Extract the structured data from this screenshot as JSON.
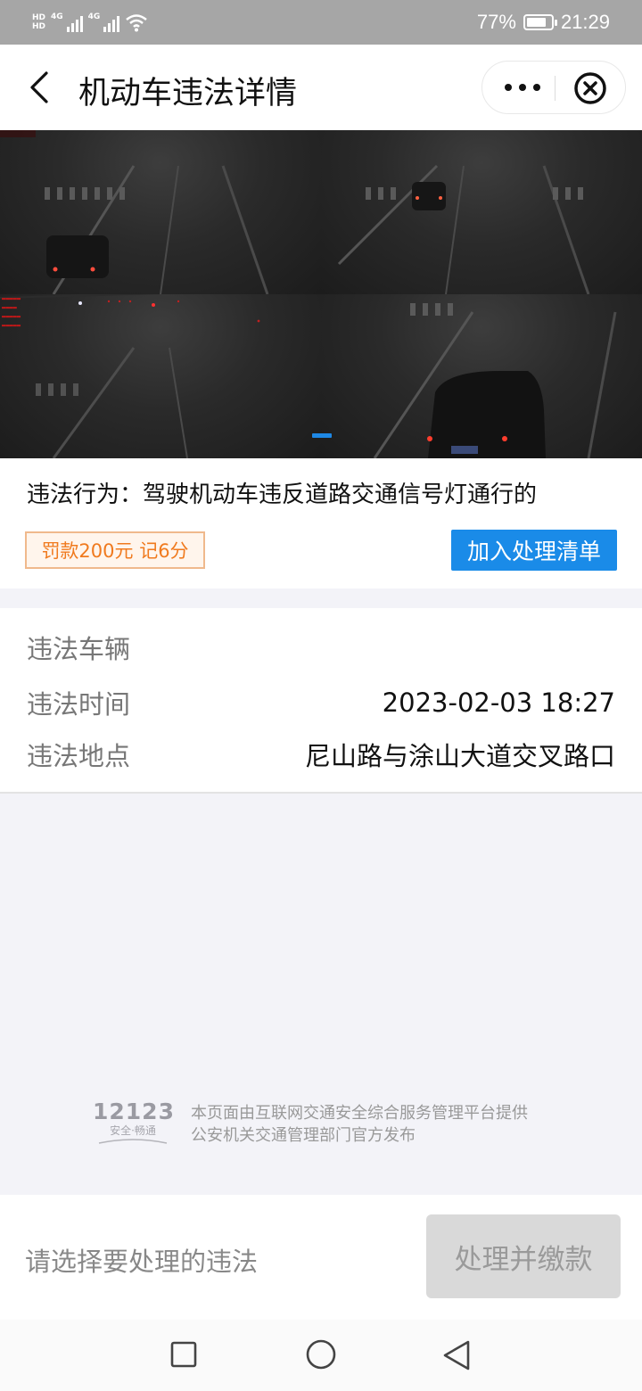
{
  "status_bar": {
    "hd1": "HD",
    "hd2": "HD",
    "net1": "4G",
    "net2": "4G",
    "battery_percent": "77%",
    "time": "21:29",
    "icons": [
      "signal-icon",
      "wifi-icon",
      "battery-icon"
    ]
  },
  "header": {
    "title": "机动车违法详情",
    "back_icon": "chevron-left-icon",
    "more_icon": "more-dots-icon",
    "close_icon": "close-circle-icon"
  },
  "gallery": {
    "image_count": 1,
    "current_index": 1
  },
  "violation": {
    "behavior": "违法行为：驾驶机动车违反道路交通信号灯通行的",
    "fine_badge": "罚款200元  记6分",
    "add_button": "加入处理清单"
  },
  "details": {
    "rows": [
      {
        "label": "违法车辆",
        "value": ""
      },
      {
        "label": "违法时间",
        "value": "2023-02-03 18:27"
      },
      {
        "label": "违法地点",
        "value": "尼山路与涂山大道交叉路口"
      }
    ]
  },
  "footer": {
    "logo_number": "12123",
    "logo_slogan": "安全·畅通",
    "line1": "本页面由互联网交通安全综合服务管理平台提供",
    "line2": "公安机关交通管理部门官方发布"
  },
  "action_bar": {
    "hint": "请选择要处理的违法",
    "pay_button": "处理并缴款"
  },
  "nav_bar": {
    "icons": [
      "recent-apps-icon",
      "home-icon",
      "back-icon"
    ]
  },
  "colors": {
    "accent": "#1a8be8",
    "fine_text": "#f07a1e",
    "fine_border": "#f0b98c"
  }
}
